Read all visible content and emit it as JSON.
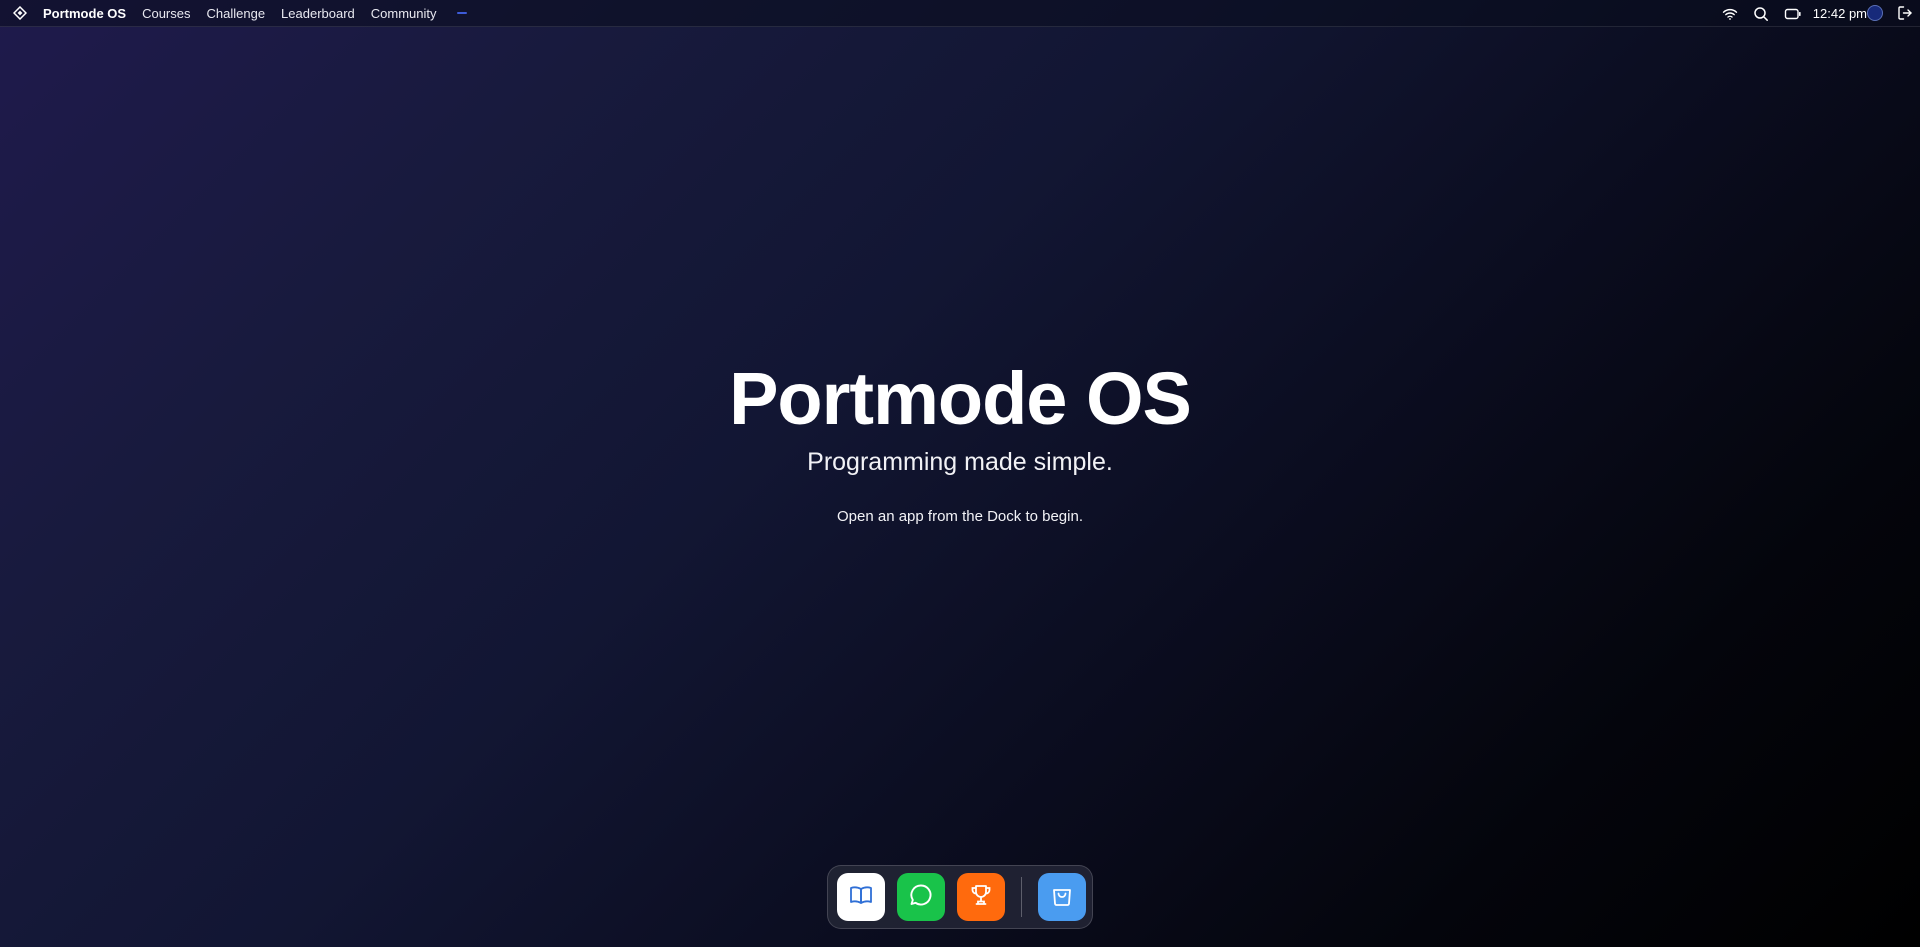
{
  "menubar": {
    "app_name": "Portmode OS",
    "items": [
      {
        "label": "Courses"
      },
      {
        "label": "Challenge"
      },
      {
        "label": "Leaderboard"
      },
      {
        "label": "Community"
      }
    ],
    "logo_icon": "diamond-logo-icon",
    "status": {
      "wifi_icon": "wifi-icon",
      "search_icon": "search-icon",
      "battery_icon": "battery-icon",
      "time": "12:42 pm",
      "avatar_icon": "avatar",
      "logout_icon": "logout-icon"
    }
  },
  "hero": {
    "title": "Portmode OS",
    "subtitle": "Programming made simple.",
    "hint": "Open an app from the Dock to begin."
  },
  "dock": {
    "apps": [
      {
        "icon": "book-open-icon",
        "color": "#ffffff"
      },
      {
        "icon": "chat-bubble-icon",
        "color": "#19c34a"
      },
      {
        "icon": "trophy-icon",
        "color": "#ff6a0d"
      },
      {
        "icon": "shopping-bag-icon",
        "color": "#4a9cf0"
      }
    ]
  },
  "colors": {
    "accent_dash": "#3d5bd8",
    "background_top": "#1f1a4c",
    "background_bottom": "#000000"
  }
}
